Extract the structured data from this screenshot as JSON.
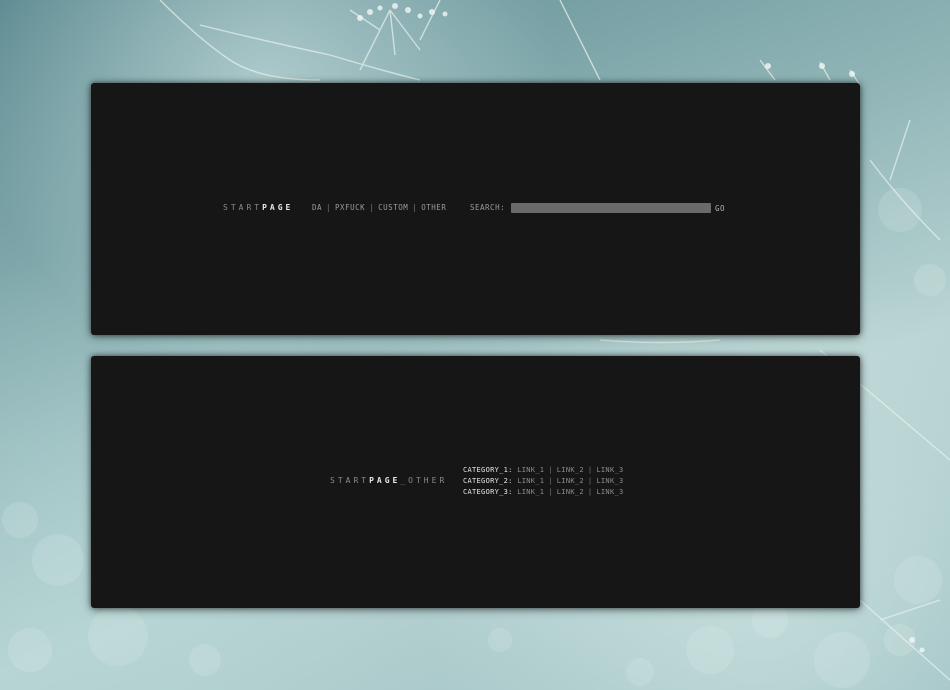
{
  "top_panel": {
    "logo": {
      "prefix": "START",
      "suffix": "PAGE"
    },
    "nav": [
      {
        "label": "DA"
      },
      {
        "label": "PXFUCK"
      },
      {
        "label": "CUSTOM"
      },
      {
        "label": "OTHER"
      }
    ],
    "nav_separator": "|",
    "search": {
      "label": "SEARCH:",
      "value": "",
      "placeholder": "",
      "button_label": "GO"
    }
  },
  "bottom_panel": {
    "logo": {
      "prefix": "START",
      "suffix": "PAGE",
      "tail": "_OTHER"
    },
    "link_separator": "|",
    "categories": [
      {
        "name": "CATEGORY_1:",
        "links": [
          "LINK_1",
          "LINK_2",
          "LINK_3"
        ]
      },
      {
        "name": "CATEGORY_2:",
        "links": [
          "LINK_1",
          "LINK_2",
          "LINK_3"
        ]
      },
      {
        "name": "CATEGORY_3:",
        "links": [
          "LINK_1",
          "LINK_2",
          "LINK_3"
        ]
      }
    ]
  },
  "colors": {
    "panel_bg": "#161616",
    "text_dim": "#9a9a9a",
    "text_bright": "#e8e8e8",
    "search_bg": "#6a6a6a"
  }
}
